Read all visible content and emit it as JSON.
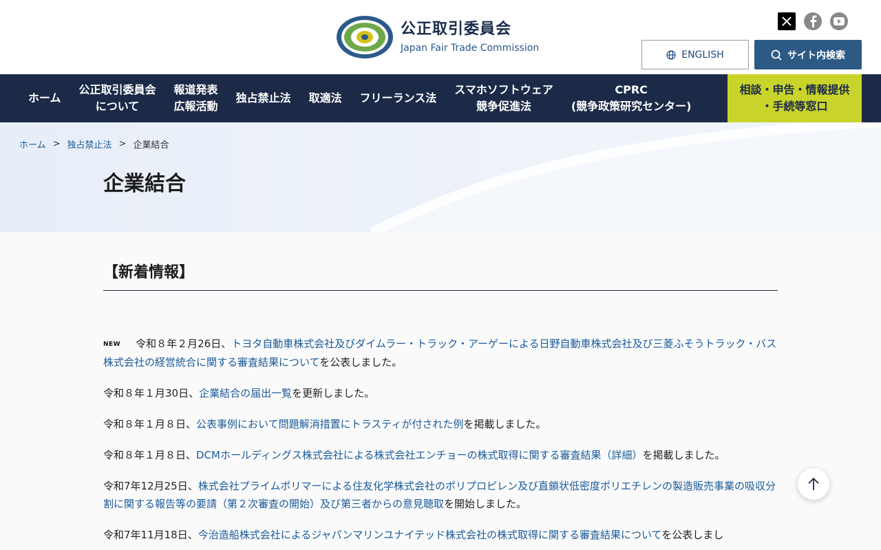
{
  "header": {
    "logo_ja": "公正取引委員会",
    "logo_en": "Japan Fair Trade Commission",
    "english_label": "ENGLISH",
    "search_label": "サイト内検索",
    "social": [
      "x-icon",
      "facebook-icon",
      "youtube-icon"
    ]
  },
  "nav": {
    "items": [
      {
        "label": "ホーム"
      },
      {
        "label": "公正取引委員会\nについて"
      },
      {
        "label": "報道発表\n広報活動"
      },
      {
        "label": "独占禁止法"
      },
      {
        "label": "取適法"
      },
      {
        "label": "フリーランス法"
      },
      {
        "label": "スマホソフトウェア\n競争促進法"
      },
      {
        "label": "CPRC\n(競争政策研究センター)"
      }
    ],
    "highlight": {
      "label": "相談・申告・情報提供\n・手続等窓口"
    }
  },
  "breadcrumb": {
    "home": "ホーム",
    "sep": ">",
    "parent": "独占禁止法",
    "current": "企業結合"
  },
  "page_title": "企業結合",
  "section_heading": "【新着情報】",
  "news": [
    {
      "badge": "NEW",
      "prefix": "令和８年２月26日、",
      "link": "トヨタ自動車株式会社及びダイムラー・トラック・アーゲーによる日野自動車株式会社及び三菱ふそうトラック・バス株式会社の経営統合に関する審査結果について",
      "suffix": "を公表しました。"
    },
    {
      "prefix": "令和８年１月30日、",
      "link": "企業結合の届出一覧",
      "suffix": "を更新しました。"
    },
    {
      "prefix": "令和８年１月８日、",
      "link": "公表事例において問題解消措置にトラスティが付された例",
      "suffix": "を掲載しました。"
    },
    {
      "prefix": "令和８年１月８日、",
      "link": "DCMホールディングス株式会社による株式会社エンチョーの株式取得に関する審査結果（詳細）",
      "suffix": "を掲載しました。"
    },
    {
      "prefix": "令和7年12月25日、",
      "link": "株式会社プライムポリマーによる住友化学株式会社のポリプロピレン及び直鎖状低密度ポリエチレンの製造販売事業の吸収分割に関する報告等の要請（第２次審査の開始）及び第三者からの意見聴取",
      "suffix": "を開始しました。"
    },
    {
      "prefix": "令和7年11月18日、",
      "link": "今治造船株式会社によるジャパンマリンユナイテッド株式会社の株式取得に関する審査結果について",
      "suffix": "を公表しまし"
    }
  ],
  "colors": {
    "nav_bg": "#1c2a48",
    "highlight_bg": "#c8d42a",
    "link": "#1a5a9a",
    "search_bg": "#2c5a85"
  }
}
